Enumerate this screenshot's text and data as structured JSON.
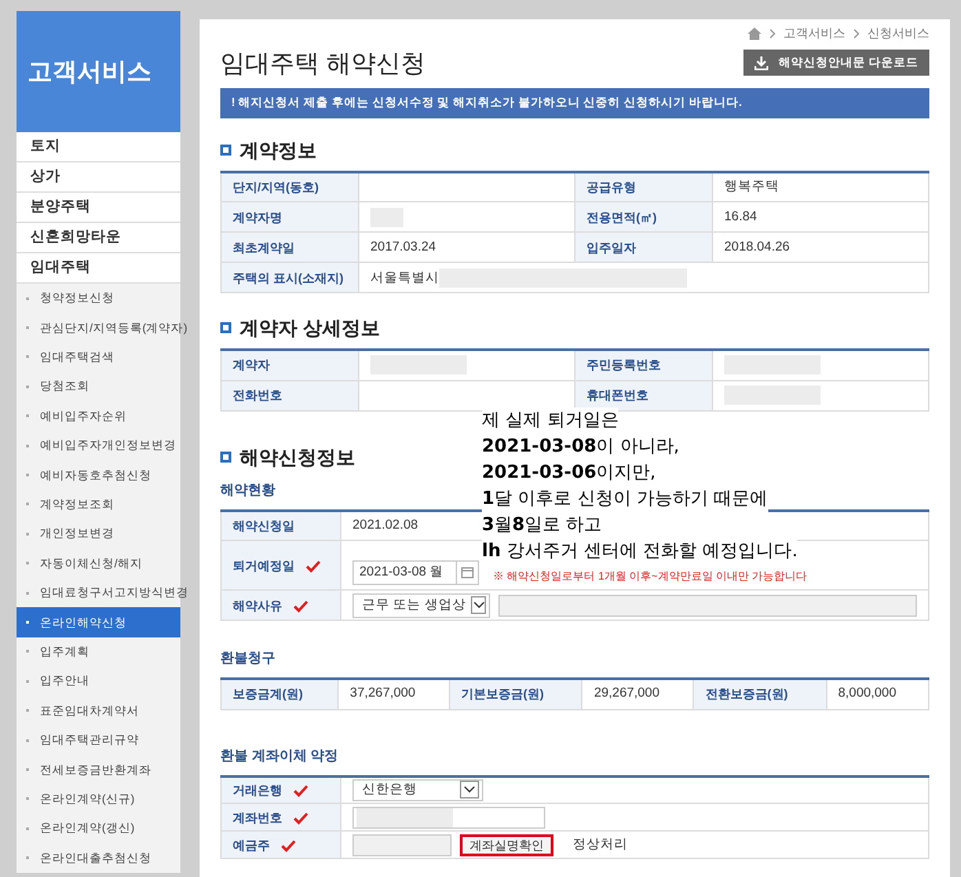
{
  "sidebar": {
    "title": "고객서비스",
    "menu": [
      {
        "label": "토지",
        "selected": false
      },
      {
        "label": "상가",
        "selected": false
      },
      {
        "label": "분양주택",
        "selected": false
      },
      {
        "label": "신혼희망타운",
        "selected": false
      },
      {
        "label": "임대주택",
        "selected": false,
        "children": [
          {
            "label": "청약정보신청",
            "selected": false
          },
          {
            "label": "관심단지/지역등록(계약자)",
            "selected": false
          },
          {
            "label": "임대주택검색",
            "selected": false
          },
          {
            "label": "당첨조회",
            "selected": false
          },
          {
            "label": "예비입주자순위",
            "selected": false
          },
          {
            "label": "예비입주자개인정보변경",
            "selected": false
          },
          {
            "label": "예비자동호추첨신청",
            "selected": false
          },
          {
            "label": "계약정보조회",
            "selected": false
          },
          {
            "label": "개인정보변경",
            "selected": false
          },
          {
            "label": "자동이체신청/해지",
            "selected": false
          },
          {
            "label": "임대료청구서고지방식변경",
            "selected": false
          },
          {
            "label": "온라인해약신청",
            "selected": true
          },
          {
            "label": "입주계획",
            "selected": false
          },
          {
            "label": "입주안내",
            "selected": false
          },
          {
            "label": "표준임대차계약서",
            "selected": false
          },
          {
            "label": "임대주택관리규약",
            "selected": false
          },
          {
            "label": "전세보증금반환계좌",
            "selected": false
          },
          {
            "label": "온라인계약(신규)",
            "selected": false
          },
          {
            "label": "온라인계약(갱신)",
            "selected": false
          },
          {
            "label": "온라인대출추첨신청",
            "selected": false
          }
        ]
      }
    ]
  },
  "breadcrumb": [
    "고객서비스",
    "신청서비스"
  ],
  "page_title": "임대주택 해약신청",
  "download_button": "해약신청안내문 다운로드",
  "notice": "! 해지신청서 제출 후에는 신청서수정 및 해지취소가 불가하오니 신중히 신청하시기 바랍니다.",
  "contract_info": {
    "title": "계약정보",
    "rows": [
      [
        {
          "label": "단지/지역(동호)",
          "redacted": false
        },
        {
          "label": "공급유형",
          "value": "행복주택",
          "redacted": false
        }
      ],
      [
        {
          "label": "계약자명",
          "redacted": true
        },
        {
          "label": "전용면적(㎡)",
          "value": "16.84",
          "redacted": false
        }
      ],
      [
        {
          "label": "최초계약일",
          "value": "2017.03.24",
          "redacted": false
        },
        {
          "label": "입주일자",
          "value": "2018.04.26",
          "redacted": false
        }
      ],
      [
        {
          "label": "주택의 표시(소재지)",
          "value": "서울특별시",
          "redacted": true
        }
      ]
    ]
  },
  "contractor_details": {
    "title": "계약자 상세정보",
    "rows": [
      [
        {
          "label": "계약자",
          "redacted": true
        },
        {
          "label": "주민등록번호",
          "redacted": true
        }
      ],
      [
        {
          "label": "전화번호",
          "redacted": false
        },
        {
          "label": "휴대폰번호",
          "redacted": true
        }
      ]
    ]
  },
  "termination": {
    "title": "해약신청정보",
    "subtitle": "해약현황",
    "rows": [
      {
        "kind": "text",
        "label": "해약신청일",
        "required": false,
        "value": "2021.02.08"
      },
      {
        "kind": "date",
        "label": "퇴거예정일",
        "required": true,
        "value": "2021-03-08 월",
        "note": "※ 해약신청일로부터 1개월 이후~계약만료일 이내만 가능합니다"
      },
      {
        "kind": "select",
        "label": "해약사유",
        "required": true,
        "value": "근무 또는 생업상"
      }
    ]
  },
  "refund": {
    "subtitle": "환불청구",
    "cells": [
      {
        "label": "보증금계(원)",
        "value": "37,267,000"
      },
      {
        "label": "기본보증금(원)",
        "value": "29,267,000"
      },
      {
        "label": "전환보증금(원)",
        "value": "8,000,000"
      }
    ]
  },
  "account": {
    "subtitle": "환불 계좌이체 약정",
    "rows": [
      {
        "kind": "select",
        "label": "거래은행",
        "required": true,
        "value": "신한은행"
      },
      {
        "kind": "input",
        "label": "계좌번호",
        "required": true
      },
      {
        "kind": "verify",
        "label": "예금주",
        "required": true,
        "button": "계좌실명확인",
        "highlighted": true,
        "status": "정상처리"
      }
    ]
  },
  "annotation": [
    "제 실제 퇴거일은",
    "**2021-03-08**이 아니라,",
    "**2021-03-06**이지만,",
    "**1**달 이후로 신청이 가능하기 때문에",
    "**3**월**8**일로 하고",
    "**lh** 강서주거 센터에 전화할 예정입니다."
  ]
}
